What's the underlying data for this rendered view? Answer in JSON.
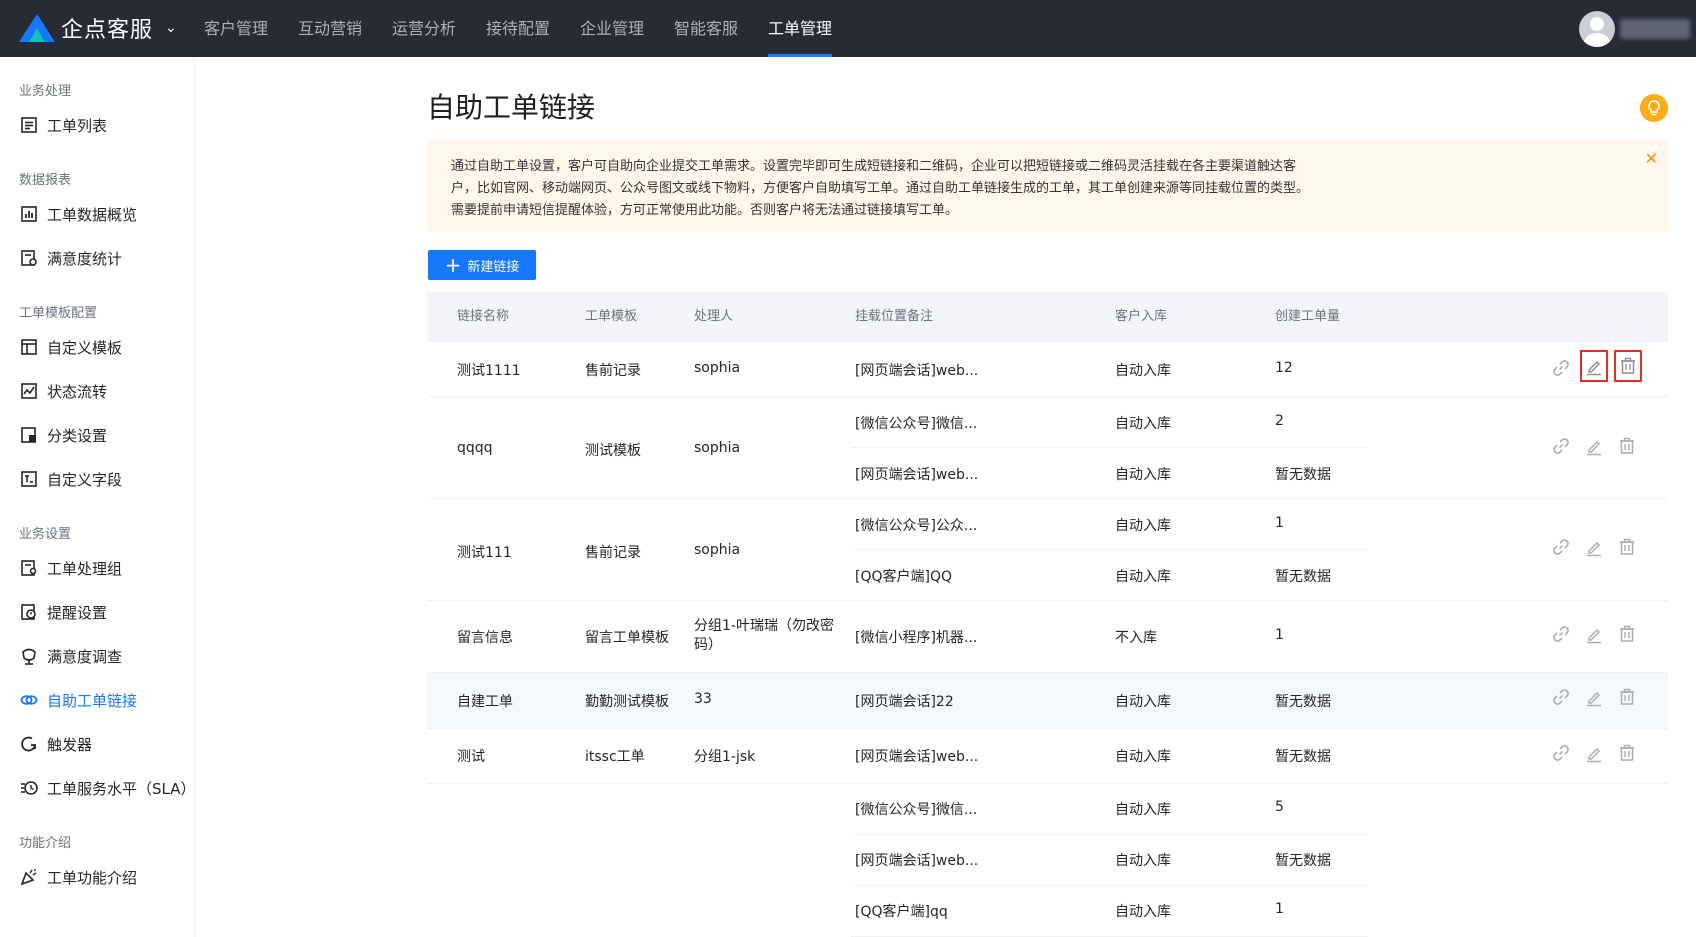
{
  "brand": {
    "name": "企点客服"
  },
  "nav": {
    "items": [
      "客户管理",
      "互动营销",
      "运营分析",
      "接待配置",
      "企业管理",
      "智能客服",
      "工单管理"
    ],
    "active": "工单管理"
  },
  "sidebar": {
    "groups": [
      {
        "title": "业务处理",
        "items": [
          {
            "label": "工单列表",
            "icon": "list-icon"
          }
        ]
      },
      {
        "title": "数据报表",
        "items": [
          {
            "label": "工单数据概览",
            "icon": "bar-chart-icon"
          },
          {
            "label": "满意度统计",
            "icon": "satisfaction-stats-icon"
          }
        ]
      },
      {
        "title": "工单模板配置",
        "items": [
          {
            "label": "自定义模板",
            "icon": "template-icon"
          },
          {
            "label": "状态流转",
            "icon": "flow-icon"
          },
          {
            "label": "分类设置",
            "icon": "category-icon"
          },
          {
            "label": "自定义字段",
            "icon": "field-icon"
          }
        ]
      },
      {
        "title": "业务设置",
        "items": [
          {
            "label": "工单处理组",
            "icon": "group-icon"
          },
          {
            "label": "提醒设置",
            "icon": "reminder-icon"
          },
          {
            "label": "满意度调查",
            "icon": "survey-icon"
          },
          {
            "label": "自助工单链接",
            "icon": "link-icon"
          },
          {
            "label": "触发器",
            "icon": "trigger-icon"
          },
          {
            "label": "工单服务水平（SLA）",
            "icon": "sla-icon"
          }
        ]
      },
      {
        "title": "功能介绍",
        "items": [
          {
            "label": "工单功能介绍",
            "icon": "party-icon"
          }
        ]
      }
    ],
    "active": "自助工单链接"
  },
  "page": {
    "title": "自助工单链接",
    "notice_lines": [
      "通过自助工单设置，客户可自助向企业提交工单需求。设置完毕即可生成短链接和二维码，企业可以把短链接或二维码灵活挂载在各主要渠道触达客",
      "户，比如官网、移动端网页、公众号图文或线下物料，方便客户自助填写工单。通过自助工单链接生成的工单，其工单创建来源等同挂载位置的类型。",
      "需要提前申请短信提醒体验，方可正常使用此功能。否则客户将无法通过链接填写工单。"
    ],
    "new_button": "新建链接"
  },
  "table": {
    "headers": [
      "链接名称",
      "工单模板",
      "处理人",
      "挂载位置备注",
      "客户入库",
      "创建工单量"
    ],
    "rows": [
      {
        "name": "测试1111",
        "template": "售前记录",
        "handler": "sophia",
        "mounts": [
          {
            "note": "[网页端会话]web...",
            "storage": "自动入库",
            "count": "12"
          }
        ]
      },
      {
        "name": "qqqq",
        "template": "测试模板",
        "handler": "sophia",
        "mounts": [
          {
            "note": "[微信公众号]微信...",
            "storage": "自动入库",
            "count": "2"
          },
          {
            "note": "[网页端会话]web...",
            "storage": "自动入库",
            "count": "暂无数据"
          }
        ]
      },
      {
        "name": "测试111",
        "template": "售前记录",
        "handler": "sophia",
        "mounts": [
          {
            "note": "[微信公众号]公众...",
            "storage": "自动入库",
            "count": "1"
          },
          {
            "note": "[QQ客户端]QQ",
            "storage": "自动入库",
            "count": "暂无数据"
          }
        ]
      },
      {
        "name": "留言信息",
        "template": "留言工单模板",
        "handler": "分组1-叶瑞瑞（勿改密码）",
        "mounts": [
          {
            "note": "[微信小程序]机器...",
            "storage": "不入库",
            "count": "1"
          }
        ]
      },
      {
        "name": "自建工单",
        "template": "勤勤测试模板",
        "handler": "33",
        "mounts": [
          {
            "note": "[网页端会话]22",
            "storage": "自动入库",
            "count": "暂无数据"
          }
        ]
      },
      {
        "name": "测试",
        "template": "itssc工单",
        "handler": "分组1-jsk",
        "mounts": [
          {
            "note": "[网页端会话]web...",
            "storage": "自动入库",
            "count": "暂无数据"
          }
        ]
      },
      {
        "name": "",
        "template": "",
        "handler": "",
        "mounts": [
          {
            "note": "[微信公众号]微信...",
            "storage": "自动入库",
            "count": "5"
          },
          {
            "note": "[网页端会话]web...",
            "storage": "自动入库",
            "count": "暂无数据"
          },
          {
            "note": "[QQ客户端]qq",
            "storage": "自动入库",
            "count": "1"
          }
        ]
      }
    ]
  },
  "colors": {
    "accent": "#1677ff",
    "nav_bg": "#262b35",
    "notice_bg": "#fff7ec",
    "highlight": "#e8302a"
  }
}
